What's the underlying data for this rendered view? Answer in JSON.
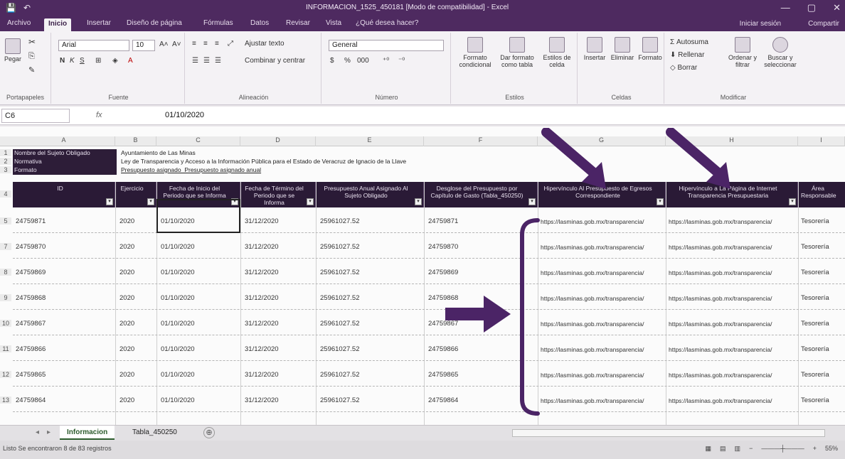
{
  "titlebar": {
    "title": "INFORMACION_1525_450181 [Modo de compatibilidad] - Excel",
    "save_glyph": "💾",
    "undo_glyph": "↶",
    "minimize_glyph": "—",
    "restore_glyph": "▢",
    "close_glyph": "✕"
  },
  "ribbon_tabs": [
    "Archivo",
    "Inicio",
    "Insertar",
    "Diseño de página",
    "Fórmulas",
    "Datos",
    "Revisar",
    "Vista",
    "¿Qué desea hacer?"
  ],
  "account": {
    "user": "Iniciar sesión",
    "share": "Compartir"
  },
  "ribbon": {
    "clipboard": {
      "paste": "Pegar",
      "label": "Portapapeles"
    },
    "font": {
      "name": "Arial",
      "size": "10",
      "bold": "N",
      "italic": "K",
      "underline": "S",
      "label": "Fuente"
    },
    "alignment": {
      "wrap": "Ajustar texto",
      "merge": "Combinar y centrar",
      "label": "Alineación"
    },
    "number": {
      "format": "General",
      "currency": "$",
      "percent": "%",
      "thousands": "000",
      "label": "Número"
    },
    "styles": {
      "conditional": "Formato condicional",
      "as_table": "Dar formato como tabla",
      "cell_styles": "Estilos de celda",
      "label": "Estilos"
    },
    "cells": {
      "insert": "Insertar",
      "delete": "Eliminar",
      "format": "Formato",
      "label": "Celdas"
    },
    "editing": {
      "autosum": "Autosuma",
      "fill": "Rellenar",
      "clear": "Borrar",
      "sort": "Ordenar y filtrar",
      "find": "Buscar y seleccionar",
      "label": "Modificar"
    }
  },
  "formula_bar": {
    "name_box": "C6",
    "fx": "fx",
    "value": "01/10/2020"
  },
  "columns": [
    "A",
    "B",
    "C",
    "D",
    "E",
    "F",
    "G",
    "H",
    "I"
  ],
  "meta": [
    {
      "row": "1",
      "label": "Nombre del Sujeto Obligado",
      "value": "Ayuntamiento de Las Minas"
    },
    {
      "row": "2",
      "label": "Normativa",
      "value": "Ley de Transparencia y Acceso a la Información Pública para el Estado de Veracruz de Ignacio de la Llave"
    },
    {
      "row": "3",
      "label": "Formato",
      "value": "Presupuesto asignado_Presupuesto asignado anual"
    }
  ],
  "headers": [
    "ID",
    "Ejercicio",
    "Fecha de Inicio del Periodo que se Informa",
    "Fecha de Término del Periodo que se Informa",
    "Presupuesto Anual Asignado Al Sujeto Obligado",
    "Desglose del Presupuesto por Capítulo de Gasto (Tabla_450250)",
    "Hipervínculo Al Presupuesto de Egresos Correspondiente",
    "Hipervínculo a La Página de Internet Transparencia Presupuestaria",
    "Área Responsable"
  ],
  "rows": [
    {
      "rownum": "5",
      "id": "24759871",
      "year": "2020",
      "start": "01/10/2020",
      "end": "31/12/2020",
      "budget": "25961027.52",
      "breakdown": "24759871",
      "link1": "https://lasminas.gob.mx/transparencia/",
      "link2": "https://lasminas.gob.mx/transparencia/",
      "area": "Tesorería"
    },
    {
      "rownum": "7",
      "id": "24759870",
      "year": "2020",
      "start": "01/10/2020",
      "end": "31/12/2020",
      "budget": "25961027.52",
      "breakdown": "24759870",
      "link1": "https://lasminas.gob.mx/transparencia/",
      "link2": "https://lasminas.gob.mx/transparencia/",
      "area": "Tesorería"
    },
    {
      "rownum": "8",
      "id": "24759869",
      "year": "2020",
      "start": "01/10/2020",
      "end": "31/12/2020",
      "budget": "25961027.52",
      "breakdown": "24759869",
      "link1": "https://lasminas.gob.mx/transparencia/",
      "link2": "https://lasminas.gob.mx/transparencia/",
      "area": "Tesorería"
    },
    {
      "rownum": "9",
      "id": "24759868",
      "year": "2020",
      "start": "01/10/2020",
      "end": "31/12/2020",
      "budget": "25961027.52",
      "breakdown": "24759868",
      "link1": "https://lasminas.gob.mx/transparencia/",
      "link2": "https://lasminas.gob.mx/transparencia/",
      "area": "Tesorería"
    },
    {
      "rownum": "10",
      "id": "24759867",
      "year": "2020",
      "start": "01/10/2020",
      "end": "31/12/2020",
      "budget": "25961027.52",
      "breakdown": "24759867",
      "link1": "https://lasminas.gob.mx/transparencia/",
      "link2": "https://lasminas.gob.mx/transparencia/",
      "area": "Tesorería"
    },
    {
      "rownum": "11",
      "id": "24759866",
      "year": "2020",
      "start": "01/10/2020",
      "end": "31/12/2020",
      "budget": "25961027.52",
      "breakdown": "24759866",
      "link1": "https://lasminas.gob.mx/transparencia/",
      "link2": "https://lasminas.gob.mx/transparencia/",
      "area": "Tesorería"
    },
    {
      "rownum": "12",
      "id": "24759865",
      "year": "2020",
      "start": "01/10/2020",
      "end": "31/12/2020",
      "budget": "25961027.52",
      "breakdown": "24759865",
      "link1": "https://lasminas.gob.mx/transparencia/",
      "link2": "https://lasminas.gob.mx/transparencia/",
      "area": "Tesorería"
    },
    {
      "rownum": "13",
      "id": "24759864",
      "year": "2020",
      "start": "01/10/2020",
      "end": "31/12/2020",
      "budget": "25961027.52",
      "breakdown": "24759864",
      "link1": "https://lasminas.gob.mx/transparencia/",
      "link2": "https://lasminas.gob.mx/transparencia/",
      "area": "Tesorería"
    }
  ],
  "sheets": [
    {
      "label": "Informacion",
      "active": true
    },
    {
      "label": "Tabla_450250",
      "active": false
    }
  ],
  "add_sheet_glyph": "⊕",
  "status": {
    "left": "Listo   Se encontraron 8 de 83 registros",
    "zoom": "55%"
  },
  "colors": {
    "title": "#4e2a60",
    "header": "#2a1a36",
    "arrow": "#4b2466"
  }
}
